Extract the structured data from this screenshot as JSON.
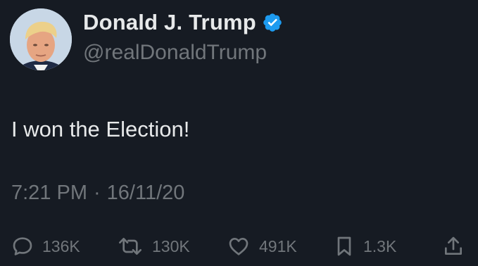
{
  "user": {
    "display_name": "Donald J. Trump",
    "handle": "@realDonaldTrump",
    "verified_icon": "verified-badge-icon",
    "verified_color": "#1d9bf0"
  },
  "tweet": {
    "text": "I won the Election!",
    "time": "7:21 PM",
    "separator": "·",
    "date": "16/11/20"
  },
  "actions": {
    "replies": "136K",
    "retweets": "130K",
    "likes": "491K",
    "bookmarks": "1.3K"
  },
  "colors": {
    "background": "#161b23",
    "primary_text": "#e7e9ea",
    "secondary_text": "#71767b"
  }
}
